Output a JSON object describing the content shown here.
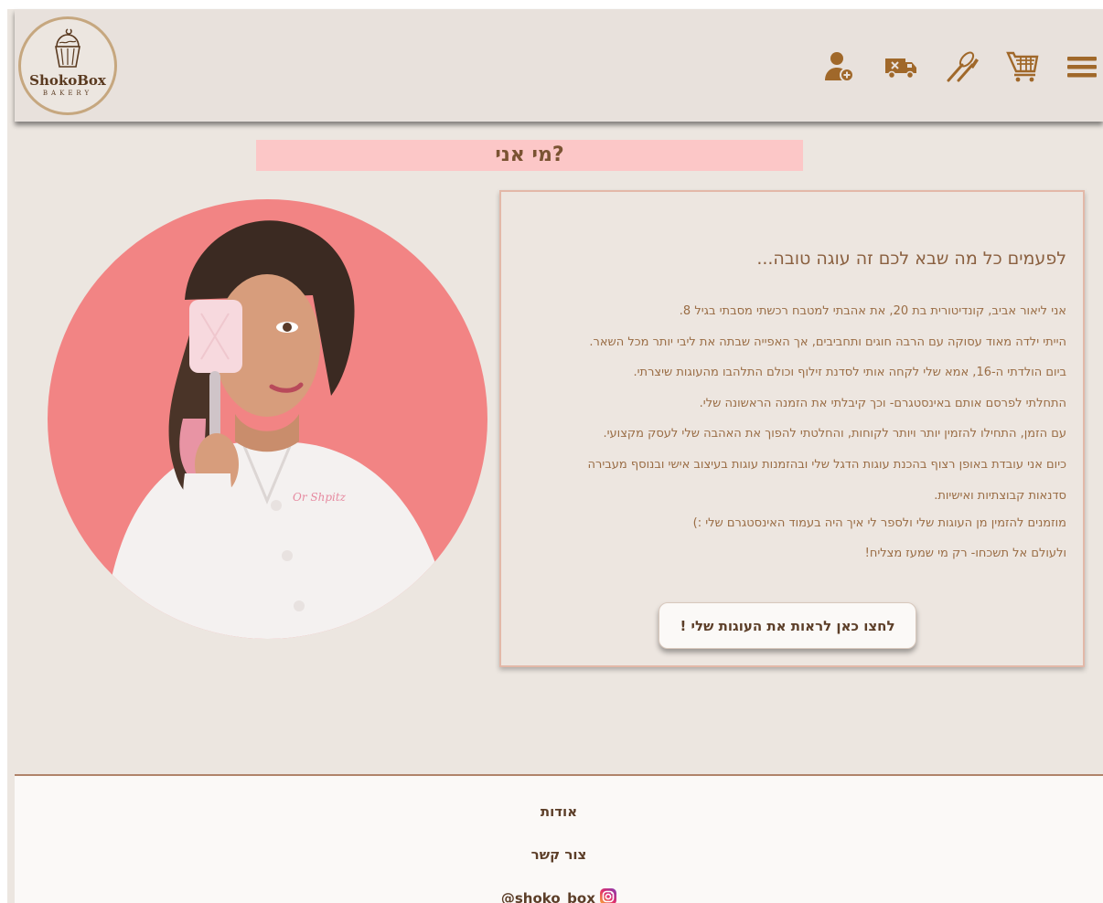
{
  "logo": {
    "name": "ShokoBox",
    "sub": "BAKERY"
  },
  "nav": {
    "icons": [
      "menu-icon",
      "cart-icon",
      "whisk-icon",
      "delivery-truck-icon",
      "user-add-icon"
    ]
  },
  "page_title": "מי אני?",
  "card": {
    "heading": "לפעמים כל מה שבא לכם זה עוגה טובה...",
    "lines": [
      "אני ליאור אביב, קונדיטורית בת 20, את אהבתי למטבח רכשתי מסבתי בגיל 8.",
      "הייתי ילדה מאוד עסוקה עם הרבה חוגים ותחביבים, אך האפייה שבתה את ליבי יותר מכל השאר.",
      "ביום הולדתי ה-16, אמא שלי לקחה אותי לסדנת זילוף וכולם התלהבו מהעוגות שיצרתי.",
      "התחלתי לפרסם אותם באינסטגרם- וכך קיבלתי את הזמנה הראשונה שלי.",
      "עם הזמן, התחילו להזמין יותר ויותר לקוחות, והחלטתי להפוך את האהבה שלי לעסק מקצועי.",
      "כיום אני עובדת באופן רצוף בהכנת עוגות הדגל שלי ובהזמנות עוגות בעיצוב אישי ובנוסף מעבירה",
      "סדנאות קבוצתיות ואישיות.",
      "מוזמנים להזמין מן העוגות שלי ולספר לי איך היה בעמוד האינסטגרם שלי :)",
      "ולעולם אל תשכחו- רק מי שמעז מצליח!"
    ],
    "button_label": "לחצו כאן לראות את העוגות שלי !"
  },
  "photo": {
    "apron_text": "Or Shpitz"
  },
  "footer": {
    "about": "אודות",
    "contact": "צור קשר",
    "instagram": "@shoko_box"
  },
  "colors": {
    "background": "#ece6e0",
    "header": "#e8e1dc",
    "title_bar": "#fcc7c7",
    "accent_brown": "#a0682a",
    "photo_pink": "#f28484"
  }
}
